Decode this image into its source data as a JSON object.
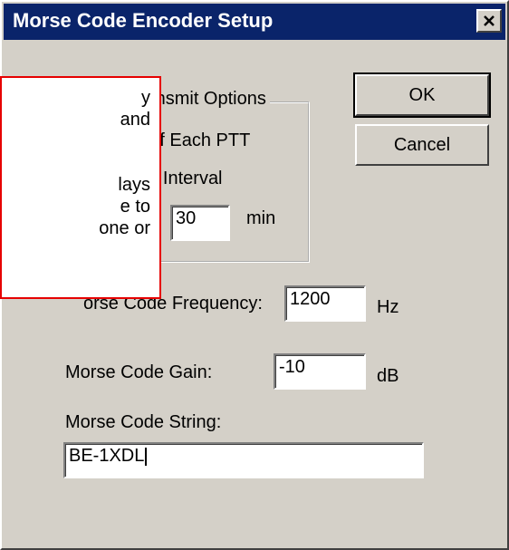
{
  "window": {
    "title": "Morse Code Encoder Setup",
    "close_symbol": "✕"
  },
  "buttons": {
    "ok": "OK",
    "cancel": "Cancel"
  },
  "auto_transmit": {
    "label": "Auto Transmit Options",
    "options": [
      {
        "label": "End of Each PTT",
        "selected": false
      },
      {
        "label": "Timer Interval",
        "selected": true
      }
    ],
    "interval_value": "30",
    "interval_unit": "min"
  },
  "frequency": {
    "label": "orse Code Frequency:",
    "value": "1200",
    "unit": "Hz"
  },
  "gain": {
    "label": "Morse Code Gain:",
    "value": "-10",
    "unit": "dB"
  },
  "code_string": {
    "label": "Morse Code String:",
    "value": "BE-1XDL"
  },
  "callout": {
    "lines": [
      "y",
      "and",
      "",
      "",
      "lays",
      "e to",
      "one or"
    ]
  },
  "colors": {
    "titlebar": "#0a246a",
    "dialog_bg": "#d4d0c8",
    "callout_border": "#e60000"
  }
}
